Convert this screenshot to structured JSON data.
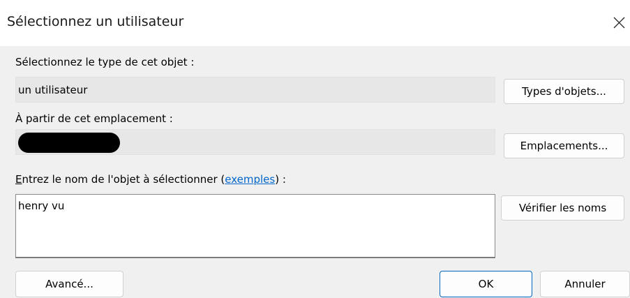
{
  "window": {
    "title": "Sélectionnez un utilisateur",
    "close_glyph": "✕"
  },
  "object_type": {
    "label": "Sélectionnez le type de cet objet :",
    "value": "un utilisateur",
    "button": "Types d'objets..."
  },
  "location": {
    "label": "À partir de cet emplacement :",
    "value_redacted": true,
    "button": "Emplacements..."
  },
  "object_name": {
    "label_accesskey": "E",
    "label_before_link": "ntrez le nom de l'objet à sélectionner (",
    "link_text": "exemples",
    "label_after_link": ") :",
    "value": "henry vu",
    "check_button": "Vérifier les noms"
  },
  "footer": {
    "advanced_button": "Avancé...",
    "ok_button": "OK",
    "cancel_button": "Annuler"
  },
  "colors": {
    "link": "#0066cc",
    "default_button_border": "#0067c0"
  }
}
